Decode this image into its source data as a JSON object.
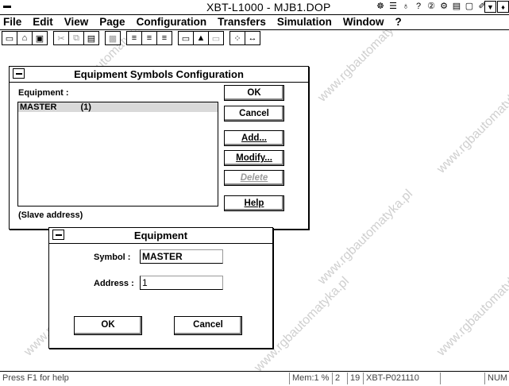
{
  "window": {
    "title": "XBT-L1000 - MJB1.DOP",
    "title_icons": [
      "☸",
      "☰",
      "♁",
      "?",
      "②",
      "⚙",
      "▤",
      "▢",
      "✐"
    ]
  },
  "menu": [
    {
      "label": "File"
    },
    {
      "label": "Edit"
    },
    {
      "label": "View"
    },
    {
      "label": "Page"
    },
    {
      "label": "Configuration"
    },
    {
      "label": "Transfers"
    },
    {
      "label": "Simulation"
    },
    {
      "label": "Window"
    },
    {
      "label": "?"
    }
  ],
  "toolbar": {
    "icons": [
      "new-icon",
      "open-icon",
      "save-icon",
      "cut-icon",
      "copy-icon",
      "paste-icon",
      "delete-icon",
      "align-left-icon",
      "align-center-icon",
      "align-right-icon",
      "rectangle-icon",
      "triangle-icon",
      "field-icon",
      "grid-icon",
      "link-icon"
    ]
  },
  "config_dialog": {
    "title": "Equipment Symbols Configuration",
    "equipment_label": "Equipment :",
    "list": [
      {
        "name": "MASTER",
        "address": "(1)"
      }
    ],
    "slave_note": "(Slave address)",
    "buttons": {
      "ok": "OK",
      "cancel": "Cancel",
      "add": "Add...",
      "modify": "Modify...",
      "delete": "Delete",
      "help": "Help"
    }
  },
  "equipment_dialog": {
    "title": "Equipment",
    "symbol_label": "Symbol :",
    "symbol_value": "MASTER",
    "address_label": "Address :",
    "address_value": "1",
    "ok": "OK",
    "cancel": "Cancel"
  },
  "status": {
    "help": "Press F1 for help",
    "mem": "Mem:1 %",
    "field2": "2",
    "field3": "19",
    "terminal": "XBT-P021110",
    "num": "NUM"
  },
  "watermark": "www.rgbautomatyka.pl"
}
